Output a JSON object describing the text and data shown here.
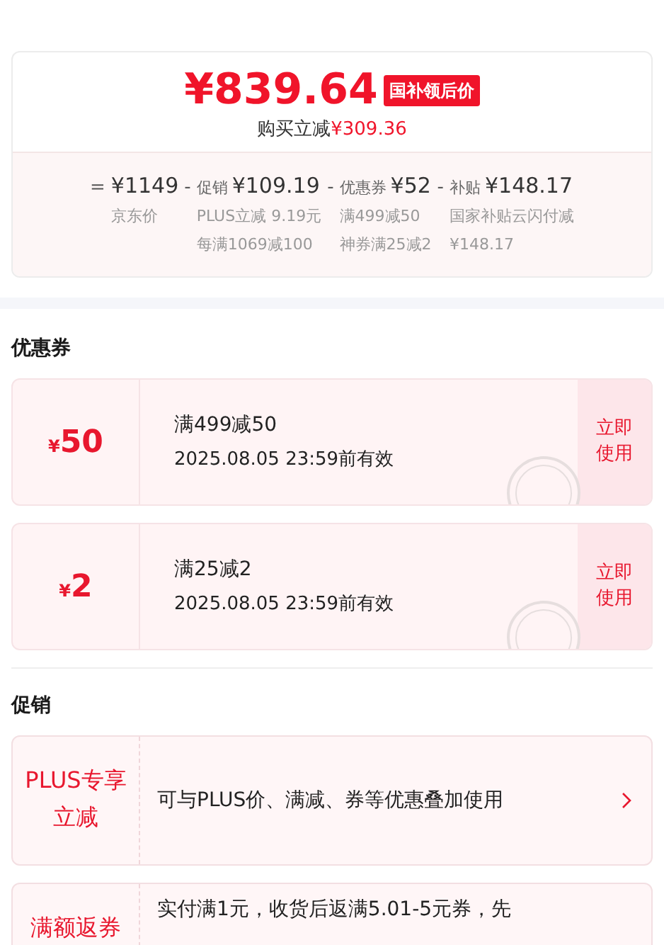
{
  "summary": {
    "final_price": "¥839.64",
    "price_tag": "国补领后价",
    "saving_label": "购买立减",
    "saving_amount": "¥309.36",
    "breakdown": [
      {
        "operator": "=",
        "amount": "¥1149",
        "notes": [
          "京东价"
        ]
      },
      {
        "operator": "-",
        "label": "促销",
        "amount": "¥109.19",
        "notes": [
          "PLUS立减 9.19元",
          "每满1069减100"
        ]
      },
      {
        "operator": "-",
        "label": "优惠券",
        "amount": "¥52",
        "notes": [
          "满499减50",
          "神券满25减2"
        ]
      },
      {
        "operator": "-",
        "label": "补贴",
        "amount": "¥148.17",
        "notes": [
          "国家补贴云闪付减",
          "¥148.17"
        ]
      }
    ]
  },
  "coupons": {
    "title": "优惠券",
    "items": [
      {
        "currency": "¥",
        "value": "50",
        "condition": "满499减50",
        "validity": "2025.08.05 23:59前有效",
        "claimed": true,
        "action": "立即使用"
      },
      {
        "currency": "¥",
        "value": "2",
        "condition": "满25减2",
        "validity": "2025.08.05 23:59前有效",
        "claimed": true,
        "action": "立即使用"
      }
    ]
  },
  "promotions": {
    "title": "促销",
    "items": [
      {
        "label": "PLUS专享立减",
        "description": "可与PLUS价、满减、券等优惠叠加使用",
        "has_arrow": true
      },
      {
        "label": "满额返券",
        "description": "实付满1元，收货后返满5.01-5元券，先",
        "has_arrow": false
      }
    ]
  }
}
